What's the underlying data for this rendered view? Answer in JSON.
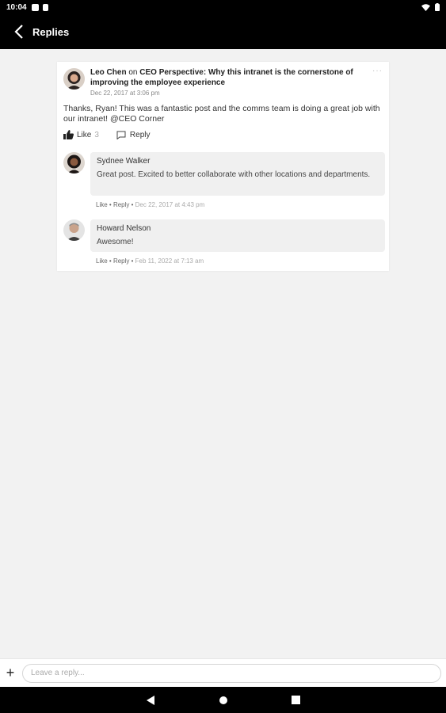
{
  "status_bar": {
    "time": "10:04"
  },
  "header": {
    "title": "Replies"
  },
  "post": {
    "author": "Leo Chen",
    "on_text": " on ",
    "topic": "CEO Perspective: Why this intranet is the cornerstone of improving the employee experience",
    "date": "Dec 22, 2017 at 3:06 pm",
    "body": "Thanks, Ryan!  This was a fantastic post and the comms team is doing a great job with our intranet! @CEO Corner",
    "like_label": "Like",
    "like_count": "3",
    "reply_label": "Reply",
    "more": "···"
  },
  "replies": [
    {
      "author": "Sydnee Walker",
      "text": "Great post.  Excited to better collaborate with other locations and departments.",
      "like": "Like",
      "sep1": " • ",
      "reply": "Reply",
      "sep2": " • ",
      "date": "Dec 22, 2017 at 4:43 pm"
    },
    {
      "author": "Howard Nelson",
      "text": "Awesome!",
      "like": "Like",
      "sep1": " • ",
      "reply": "Reply",
      "sep2": " • ",
      "date": "Feb 11, 2022 at 7:13 am"
    }
  ],
  "composer": {
    "plus": "+",
    "placeholder": "Leave a reply..."
  },
  "colors": {
    "bars": "#000000",
    "background": "#f2f2f2",
    "card": "#ffffff",
    "bubble": "#f0f0f0"
  }
}
